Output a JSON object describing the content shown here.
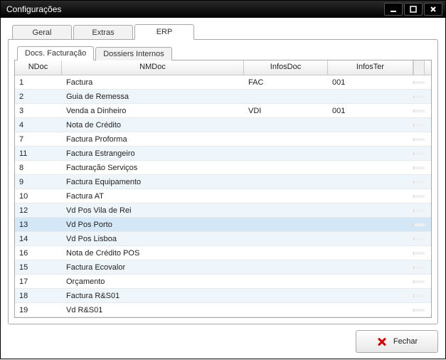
{
  "window": {
    "title": "Configurações"
  },
  "outerTabs": {
    "items": [
      {
        "label": "Geral"
      },
      {
        "label": "Extras"
      },
      {
        "label": "ERP"
      }
    ],
    "activeIndex": 2
  },
  "innerTabs": {
    "items": [
      {
        "label": "Docs. Facturação"
      },
      {
        "label": "Dossiers Internos"
      }
    ],
    "activeIndex": 0
  },
  "grid": {
    "columns": [
      {
        "key": "ndoc",
        "label": "NDoc"
      },
      {
        "key": "nmdoc",
        "label": "NMDoc"
      },
      {
        "key": "infosdoc",
        "label": "InfosDoc"
      },
      {
        "key": "infoster",
        "label": "InfosTer"
      }
    ],
    "selectedIndex": 10,
    "rows": [
      {
        "ndoc": "1",
        "nmdoc": "Factura",
        "infosdoc": "FAC",
        "infoster": "001"
      },
      {
        "ndoc": "2",
        "nmdoc": "Guia de Remessa",
        "infosdoc": "",
        "infoster": ""
      },
      {
        "ndoc": "3",
        "nmdoc": "Venda a Dinheiro",
        "infosdoc": "VDI",
        "infoster": "001"
      },
      {
        "ndoc": "4",
        "nmdoc": "Nota de Crédito",
        "infosdoc": "",
        "infoster": ""
      },
      {
        "ndoc": "7",
        "nmdoc": "Factura Proforma",
        "infosdoc": "",
        "infoster": ""
      },
      {
        "ndoc": "11",
        "nmdoc": "Factura Estrangeiro",
        "infosdoc": "",
        "infoster": ""
      },
      {
        "ndoc": "8",
        "nmdoc": "Facturação Serviços",
        "infosdoc": "",
        "infoster": ""
      },
      {
        "ndoc": "9",
        "nmdoc": "Factura Equipamento",
        "infosdoc": "",
        "infoster": ""
      },
      {
        "ndoc": "10",
        "nmdoc": "Factura AT",
        "infosdoc": "",
        "infoster": ""
      },
      {
        "ndoc": "12",
        "nmdoc": "Vd Pos Vila de Rei",
        "infosdoc": "",
        "infoster": ""
      },
      {
        "ndoc": "13",
        "nmdoc": "Vd Pos Porto",
        "infosdoc": "",
        "infoster": ""
      },
      {
        "ndoc": "14",
        "nmdoc": "Vd Pos Lisboa",
        "infosdoc": "",
        "infoster": ""
      },
      {
        "ndoc": "16",
        "nmdoc": "Nota de Crédito POS",
        "infosdoc": "",
        "infoster": ""
      },
      {
        "ndoc": "15",
        "nmdoc": "Factura Ecovalor",
        "infosdoc": "",
        "infoster": ""
      },
      {
        "ndoc": "17",
        "nmdoc": "Orçamento",
        "infosdoc": "",
        "infoster": ""
      },
      {
        "ndoc": "18",
        "nmdoc": "Factura R&S01",
        "infosdoc": "",
        "infoster": ""
      },
      {
        "ndoc": "19",
        "nmdoc": "Vd R&S01",
        "infosdoc": "",
        "infoster": ""
      }
    ]
  },
  "footer": {
    "close_label": "Fechar"
  }
}
